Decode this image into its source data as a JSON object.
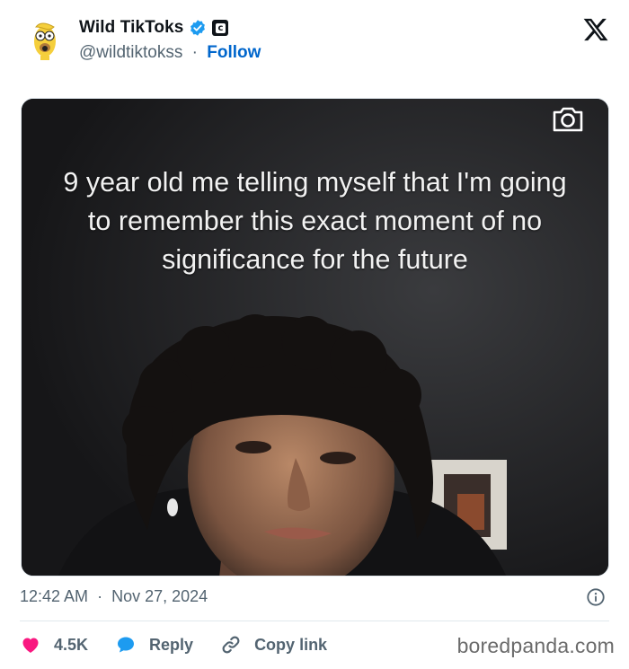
{
  "header": {
    "display_name": "Wild TikToks",
    "handle": "@wildtiktokss",
    "separator": "·",
    "follow_label": "Follow",
    "gov_badge_letter": "c"
  },
  "media": {
    "caption": "9 year old me telling myself that I'm going to remember this exact moment of no significance for the future"
  },
  "meta": {
    "time": "12:42 AM",
    "separator": "·",
    "date": "Nov 27, 2024"
  },
  "actions": {
    "likes": "4.5K",
    "reply_label": "Reply",
    "copy_link_label": "Copy link"
  },
  "watermark": "boredpanda.com",
  "colors": {
    "link_blue": "#0066cc",
    "verified_blue": "#1d9bf0",
    "like_pink": "#f91880",
    "reply_blue": "#1d9bf0",
    "muted_text": "#536471"
  }
}
